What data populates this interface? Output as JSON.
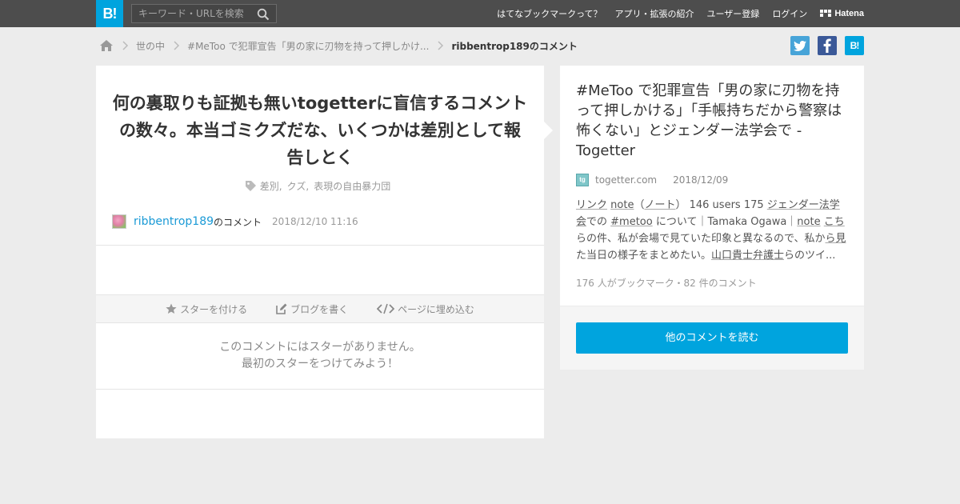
{
  "header": {
    "logo_text": "B!",
    "search_placeholder": "キーワード・URLを検索",
    "nav": [
      "はてなブックマークって？",
      "アプリ・拡張の紹介",
      "ユーザー登録",
      "ログイン"
    ],
    "brand": "Hatena"
  },
  "breadcrumb": {
    "items": [
      "世の中",
      "#MeToo で犯罪宣告「男の家に刃物を持って押しかけ..."
    ],
    "current": "ribbentrop189のコメント"
  },
  "comment": {
    "text": "何の裏取りも証拠も無いtogetterに盲信するコメントの数々。本当ゴミクズだな、いくつかは差別として報告しとく",
    "tags": [
      "差別,",
      "クズ,",
      "表現の自由暴力団"
    ],
    "username": "ribbentrop189",
    "username_suffix": "のコメント",
    "timestamp": "2018/12/10 11:16"
  },
  "actions": {
    "star": "スターを付ける",
    "blog": "ブログを書く",
    "embed": "ページに埋め込む"
  },
  "no_stars": {
    "line1": "このコメントにはスターがありません。",
    "line2": "最初のスターをつけてみよう！"
  },
  "entry": {
    "title": "#MeToo で犯罪宣告「男の家に刃物を持って押しかける」「手帳持ちだから警察は怖くない」とジェンダー法学会で - Togetter",
    "domain": "togetter.com",
    "date": "2018/12/09",
    "summary": {
      "s1": "リンク",
      "s2": " ",
      "s3": "note",
      "s4": "（",
      "s5": "ノート",
      "s6": "） 146 users 175 ",
      "s7": "ジェンダー法学会",
      "s8": "での ",
      "s9": "#metoo",
      "s10": " について｜Tamaka Ogawa｜",
      "s11": "note",
      "s12": " ",
      "s13": "こち",
      "s14": "らの件、私が会場で見ていた印象と異なるので、私か",
      "s15": "ら見",
      "s16": "た当日の様子をまとめたい。",
      "s17": "山口貴士弁護士",
      "s18": "らのツイ..."
    },
    "stats": "176 人がブックマーク・82 件のコメント",
    "read_more": "他のコメントを読む"
  },
  "colors": {
    "brand_blue": "#00a4de",
    "header_bg": "#4d4d4d",
    "link_blue": "#1a9ad6"
  }
}
